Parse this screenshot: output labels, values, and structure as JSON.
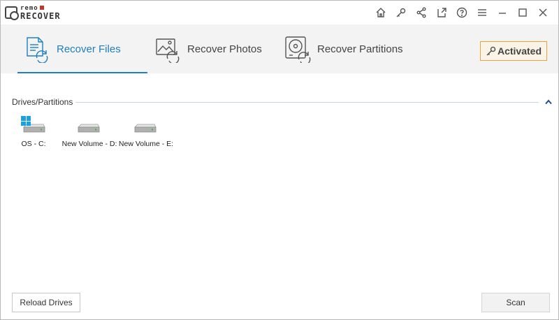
{
  "app": {
    "logo_top": "remo",
    "logo_bottom": "RECOVER"
  },
  "title_actions": [
    {
      "name": "home-icon"
    },
    {
      "name": "key-icon"
    },
    {
      "name": "share-icon"
    },
    {
      "name": "external-link-icon"
    },
    {
      "name": "help-icon"
    },
    {
      "name": "menu-icon"
    },
    {
      "name": "minimize-icon"
    },
    {
      "name": "maximize-icon"
    },
    {
      "name": "close-icon"
    }
  ],
  "tabs": [
    {
      "label": "Recover Files",
      "icon": "recover-files-icon",
      "active": true
    },
    {
      "label": "Recover Photos",
      "icon": "recover-photos-icon",
      "active": false
    },
    {
      "label": "Recover Partitions",
      "icon": "recover-partitions-icon",
      "active": false
    }
  ],
  "activation": {
    "label": "Activated",
    "icon": "key-icon"
  },
  "drives_section": {
    "title": "Drives/Partitions",
    "drives": [
      {
        "label": "OS - C:",
        "os_drive": true
      },
      {
        "label": "New Volume - D:",
        "os_drive": false
      },
      {
        "label": "New Volume - E:",
        "os_drive": false
      }
    ]
  },
  "buttons": {
    "reload": "Reload Drives",
    "scan": "Scan"
  },
  "colors": {
    "accent": "#1e7fc1",
    "activated_border": "#e8a33a",
    "windows_blue": "#1ba1e2",
    "logo_red": "#c0392b"
  }
}
